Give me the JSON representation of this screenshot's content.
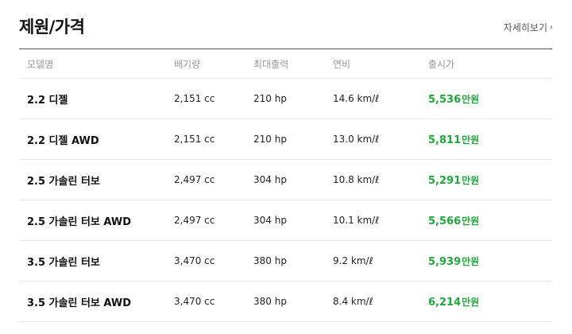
{
  "header": {
    "title": "제원/가격",
    "more_label": "자세히보기",
    "more_chevron": "›"
  },
  "table": {
    "columns": [
      "모델명",
      "배기량",
      "최대출력",
      "연비",
      "출시가"
    ],
    "rows": [
      {
        "model": "2.2 디젤",
        "displacement": "2,151 cc",
        "power": "210 hp",
        "efficiency": "14.6 km/ℓ",
        "price": "5,536",
        "unit": "만원"
      },
      {
        "model": "2.2 디젤 AWD",
        "displacement": "2,151 cc",
        "power": "210 hp",
        "efficiency": "13.0 km/ℓ",
        "price": "5,811",
        "unit": "만원"
      },
      {
        "model": "2.5 가솔린 터보",
        "displacement": "2,497 cc",
        "power": "304 hp",
        "efficiency": "10.8 km/ℓ",
        "price": "5,291",
        "unit": "만원"
      },
      {
        "model": "2.5 가솔린 터보 AWD",
        "displacement": "2,497 cc",
        "power": "304 hp",
        "efficiency": "10.1 km/ℓ",
        "price": "5,566",
        "unit": "만원"
      },
      {
        "model": "3.5 가솔린 터보",
        "displacement": "3,470 cc",
        "power": "380 hp",
        "efficiency": "9.2 km/ℓ",
        "price": "5,939",
        "unit": "만원"
      },
      {
        "model": "3.5 가솔린 터보 AWD",
        "displacement": "3,470 cc",
        "power": "380 hp",
        "efficiency": "8.4 km/ℓ",
        "price": "6,214",
        "unit": "만원"
      }
    ]
  },
  "colors": {
    "price": "#1fa83a",
    "header_rule": "#555555",
    "row_divider": "#e8e8e8"
  }
}
